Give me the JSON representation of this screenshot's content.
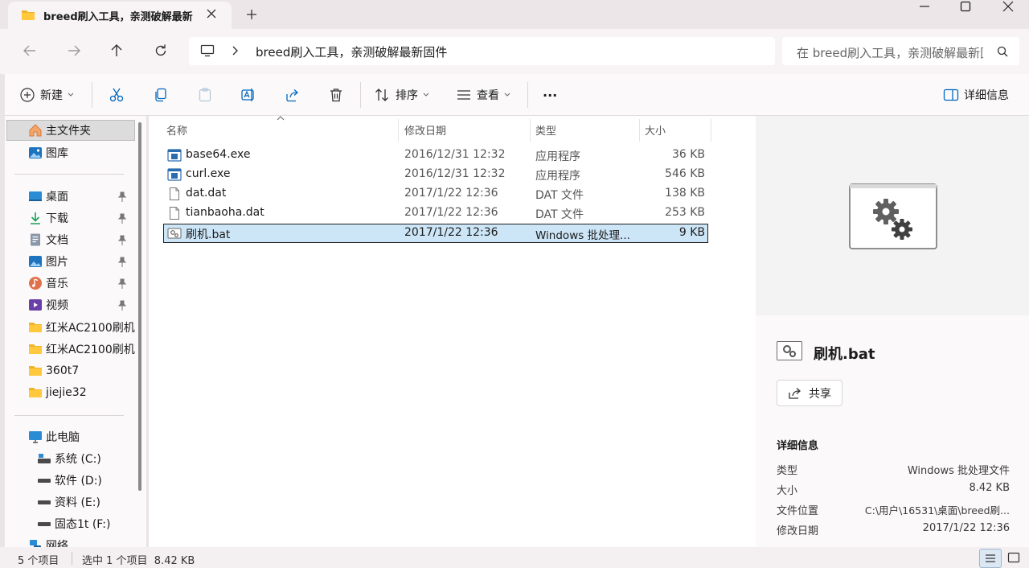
{
  "window": {
    "tab_title": "breed刷入工具，亲测破解最新",
    "tab_icon": "folder-icon",
    "accent": "#0067c0",
    "selection_color": "#cde6f7"
  },
  "address": {
    "path": "breed刷入工具，亲测破解最新固件",
    "search_placeholder": "在 breed刷入工具，亲测破解最新固件 中搜索"
  },
  "toolbar": {
    "new_label": "新建",
    "sort_label": "排序",
    "view_label": "查看",
    "more_label": "···",
    "details_label": "详细信息"
  },
  "nav": {
    "home": "主文件夹",
    "gallery": "图库",
    "pinned": [
      {
        "label": "桌面",
        "icon": "desktop-icon"
      },
      {
        "label": "下载",
        "icon": "download-icon"
      },
      {
        "label": "文档",
        "icon": "document-icon"
      },
      {
        "label": "图片",
        "icon": "pictures-icon"
      },
      {
        "label": "音乐",
        "icon": "music-icon"
      },
      {
        "label": "视频",
        "icon": "video-icon"
      }
    ],
    "folders": [
      "红米AC2100刷机",
      "红米AC2100刷机",
      "360t7",
      "jiejie32"
    ],
    "this_pc": "此电脑",
    "drives": [
      "系统 (C:)",
      "软件 (D:)",
      "资料 (E:)",
      "固态1t (F:)"
    ],
    "network": "网络"
  },
  "columns": {
    "name": "名称",
    "date": "修改日期",
    "type": "类型",
    "size": "大小"
  },
  "files": [
    {
      "name": "base64.exe",
      "date": "2016/12/31 12:32",
      "type": "应用程序",
      "size": "36 KB",
      "icon": "exe-icon"
    },
    {
      "name": "curl.exe",
      "date": "2016/12/31 12:32",
      "type": "应用程序",
      "size": "546 KB",
      "icon": "exe-icon"
    },
    {
      "name": "dat.dat",
      "date": "2017/1/22 12:36",
      "type": "DAT 文件",
      "size": "138 KB",
      "icon": "file-icon"
    },
    {
      "name": "tianbaoha.dat",
      "date": "2017/1/22 12:36",
      "type": "DAT 文件",
      "size": "253 KB",
      "icon": "file-icon"
    },
    {
      "name": "刷机.bat",
      "date": "2017/1/22 12:36",
      "type": "Windows 批处理...",
      "size": "9 KB",
      "icon": "batch-file-icon",
      "selected": true
    }
  ],
  "details": {
    "file_name": "刷机.bat",
    "share_label": "共享",
    "section_title": "详细信息",
    "props": [
      {
        "key": "类型",
        "value": "Windows 批处理文件"
      },
      {
        "key": "大小",
        "value": "8.42 KB"
      },
      {
        "key": "文件位置",
        "value": "C:\\用户\\16531\\桌面\\breed刷..."
      },
      {
        "key": "修改日期",
        "value": "2017/1/22 12:36"
      }
    ]
  },
  "status": {
    "count": "5 个项目",
    "selection": "选中 1 个项目  8.42 KB"
  }
}
